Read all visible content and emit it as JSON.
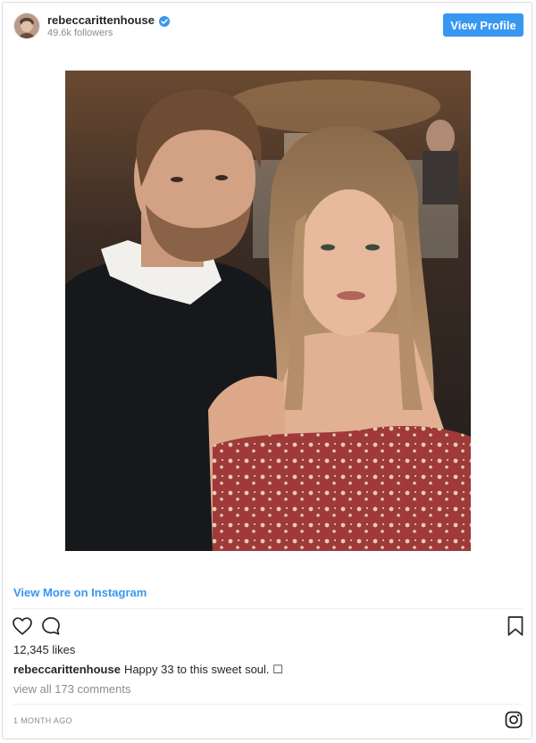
{
  "post": {
    "username": "rebeccarittenhouse",
    "followers": "49.6k followers",
    "view_profile_label": "View Profile",
    "view_more_label": "View More on Instagram",
    "likes": "12,345 likes",
    "caption_user": "rebeccarittenhouse",
    "caption_text": "Happy 33 to this sweet soul. ☐",
    "comments_link": "view all 173 comments",
    "timestamp": "1 MONTH AGO"
  },
  "icons": {
    "verified": "verified-badge-icon",
    "like": "heart-icon",
    "comment": "comment-icon",
    "save": "bookmark-icon",
    "brand": "instagram-logo-icon"
  },
  "colors": {
    "accent": "#3897f0",
    "muted_text": "#8e8e8e",
    "text": "#262626",
    "border": "#dbdbdb"
  }
}
